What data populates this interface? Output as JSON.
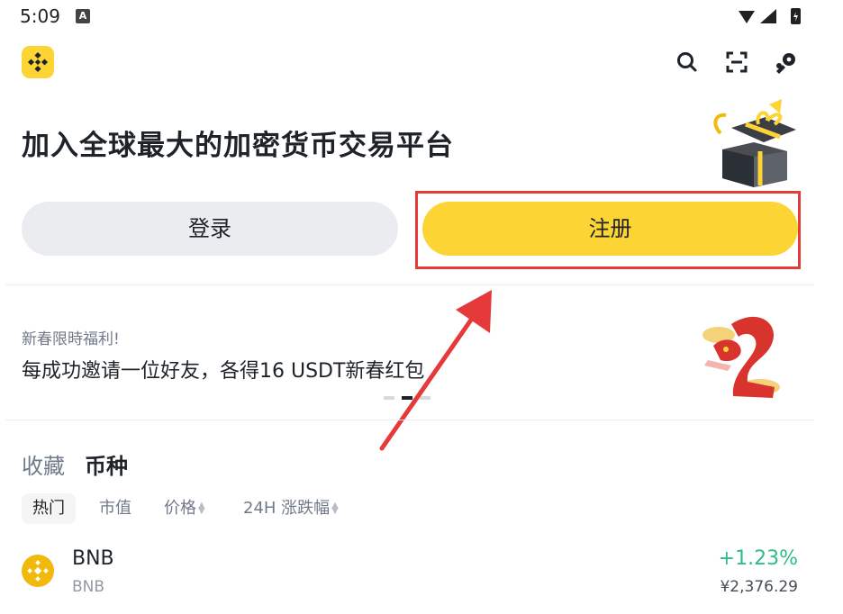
{
  "status_bar": {
    "time": "5:09",
    "badge": "A"
  },
  "header": {
    "logo": "binance-logo",
    "icons": [
      "search-icon",
      "scan-icon",
      "support-icon"
    ]
  },
  "hero": {
    "headline": "加入全球最大的加密货币交易平台",
    "login_label": "登录",
    "register_label": "注册"
  },
  "promo": {
    "small": "新春限時福利!",
    "big": "每成功邀请一位好友，各得16 USDT新春红包"
  },
  "market": {
    "tabs": [
      "收藏",
      "币种"
    ],
    "filters": [
      "热门",
      "市值",
      "价格",
      "24H 涨跌幅"
    ],
    "rows": [
      {
        "symbol": "BNB",
        "name": "BNB",
        "change": "+1.23%",
        "price": "¥2,376.29"
      }
    ]
  },
  "colors": {
    "brand": "#fcd535",
    "positive": "#2ebd85",
    "annotation": "#e43a3a"
  }
}
